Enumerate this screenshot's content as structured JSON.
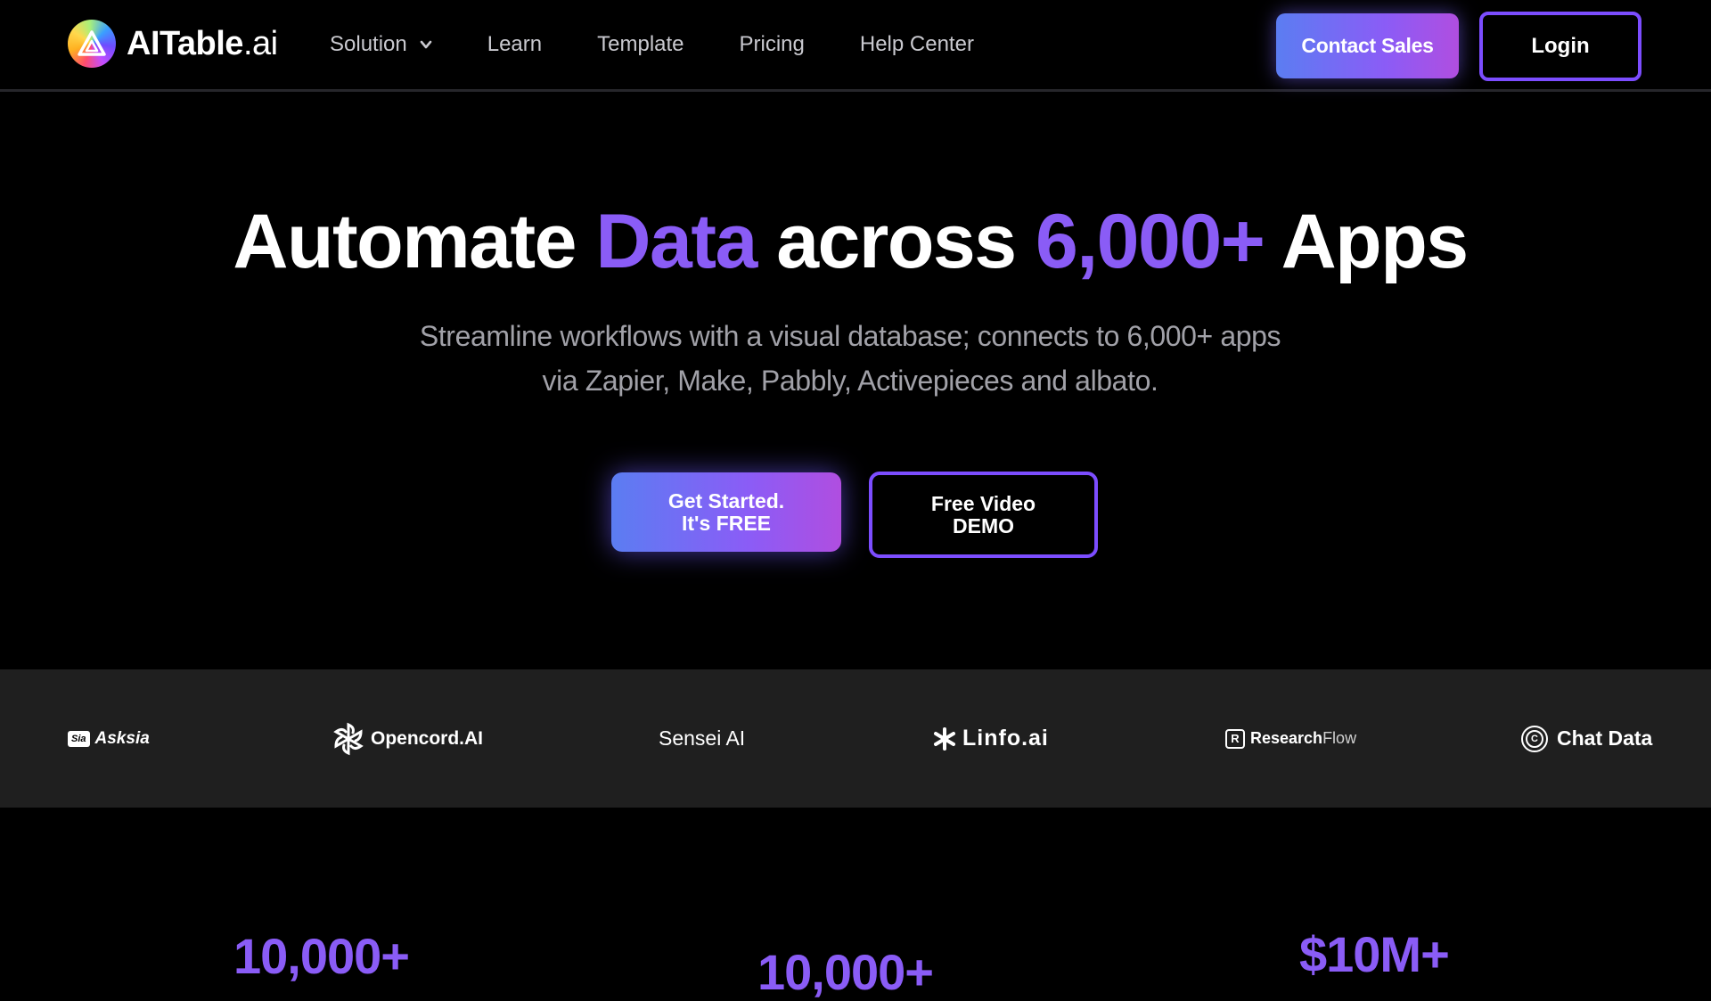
{
  "brand": {
    "name_bold": "AITable",
    "name_light": ".ai",
    "logo_icon": "aitable-logo-icon"
  },
  "nav": {
    "items": [
      {
        "label": "Solution",
        "has_dropdown": true
      },
      {
        "label": "Learn"
      },
      {
        "label": "Template"
      },
      {
        "label": "Pricing"
      },
      {
        "label": "Help Center"
      }
    ],
    "contact_label": "Contact Sales",
    "login_label": "Login"
  },
  "hero": {
    "title_parts": [
      "Automate",
      "Data",
      "across",
      "6,000+",
      "Apps"
    ],
    "subtitle_line1": "Streamline workflows with a visual database; connects to 6,000+ apps",
    "subtitle_line2": "via Zapier, Make, Pabbly, Activepieces and albato.",
    "cta_primary_line1": "Get Started.",
    "cta_primary_line2": "It's FREE",
    "cta_secondary_line1": "Free Video",
    "cta_secondary_line2": "DEMO"
  },
  "partners": [
    {
      "name": "Asksia",
      "badge": "Sia",
      "icon": "asksia-logo-icon"
    },
    {
      "name": "Opencord.AI",
      "icon": "opencord-logo-icon"
    },
    {
      "name": "Sensei AI"
    },
    {
      "name": "Linfo.ai",
      "icon": "linfo-asterisk-icon"
    },
    {
      "name_bold": "Research",
      "name_light": "Flow",
      "badge": "R",
      "icon": "researchflow-logo-icon"
    },
    {
      "name": "Chat Data",
      "badge": "C",
      "icon": "chatdata-logo-icon"
    }
  ],
  "stats": [
    "10,000+",
    "10,000+",
    "$10M+"
  ],
  "colors": {
    "background": "#000000",
    "accent": "#8a5cf6",
    "button_border": "#7c4dff",
    "gradient_start": "#5b7df2",
    "gradient_end": "#b04ee0",
    "strip_bg": "#1f1f1f",
    "muted_text": "#a1a1a8"
  }
}
